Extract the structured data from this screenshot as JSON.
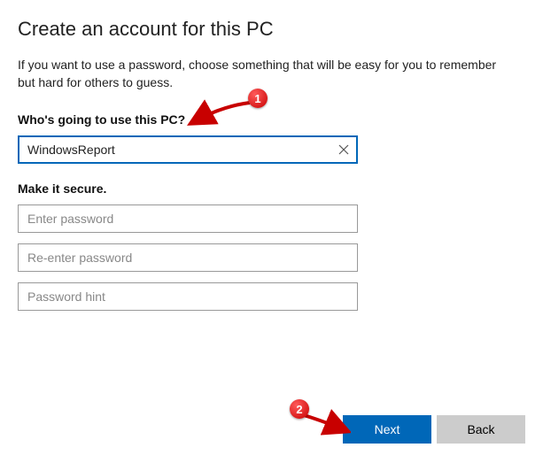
{
  "title": "Create an account for this PC",
  "intro": "If you want to use a password, choose something that will be easy for you to remember but hard for others to guess.",
  "section_user": {
    "label": "Who's going to use this PC?",
    "username_value": "WindowsReport"
  },
  "section_secure": {
    "label": "Make it secure.",
    "password_placeholder": "Enter password",
    "reenter_placeholder": "Re-enter password",
    "hint_placeholder": "Password hint"
  },
  "buttons": {
    "next": "Next",
    "back": "Back"
  },
  "annotations": {
    "callout1": "1",
    "callout2": "2"
  },
  "colors": {
    "accent": "#0067b8",
    "callout": "#c80000"
  }
}
